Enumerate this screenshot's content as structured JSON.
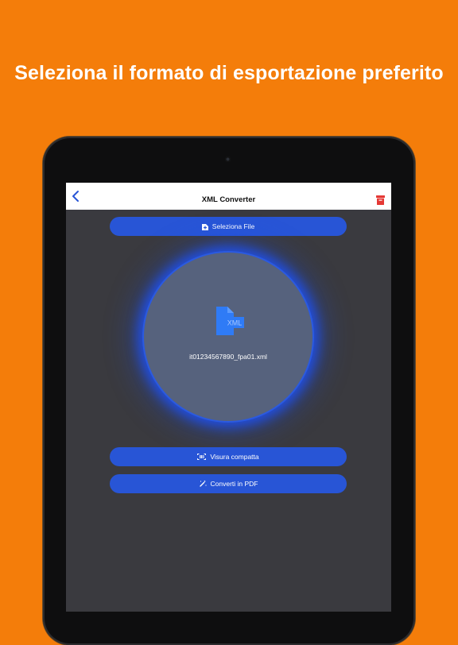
{
  "headline": "Seleziona il formato di esportazione preferito",
  "navbar": {
    "title": "XML Converter",
    "back_icon": "chevron-left-icon",
    "delete_icon": "trash-icon"
  },
  "buttons": {
    "select_file": "Seleziona File",
    "visura": "Visura compatta",
    "pdf": "Converti in PDF"
  },
  "file": {
    "icon": "xml-file-icon",
    "icon_text": "XML",
    "name": "it01234567890_fpa01.xml"
  },
  "colors": {
    "background": "#f47d0a",
    "accent": "#2855d6",
    "screen": "#3a3a3f",
    "circle": "#56627d",
    "delete": "#e53935"
  }
}
